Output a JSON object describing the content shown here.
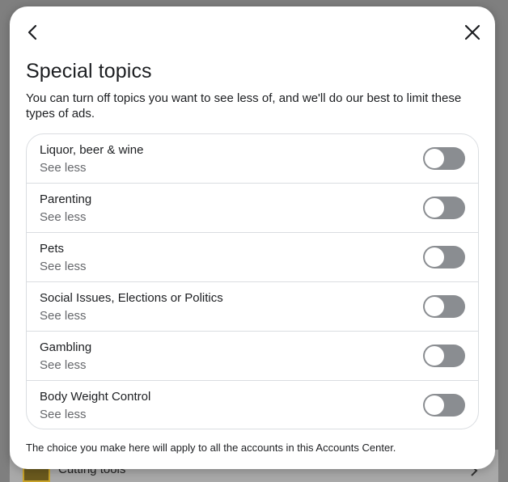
{
  "background": {
    "item_label": "Cutting tools"
  },
  "modal": {
    "title": "Special topics",
    "description": "You can turn off topics you want to see less of, and we'll do our best to limit these types of ads.",
    "footer": "The choice you make here will apply to all the accounts in this Accounts Center.",
    "topics": [
      {
        "label": "Liquor, beer & wine",
        "status": "See less",
        "enabled": false
      },
      {
        "label": "Parenting",
        "status": "See less",
        "enabled": false
      },
      {
        "label": "Pets",
        "status": "See less",
        "enabled": false
      },
      {
        "label": "Social Issues, Elections or Politics",
        "status": "See less",
        "enabled": false
      },
      {
        "label": "Gambling",
        "status": "See less",
        "enabled": false
      },
      {
        "label": "Body Weight Control",
        "status": "See less",
        "enabled": false
      }
    ]
  },
  "icons": {
    "back": "chevron-left-icon",
    "close": "close-icon"
  },
  "colors": {
    "toggle_off": "#8a8d91",
    "text_primary": "#1c1e21",
    "text_secondary": "#65676b",
    "divider": "#dadde1"
  }
}
